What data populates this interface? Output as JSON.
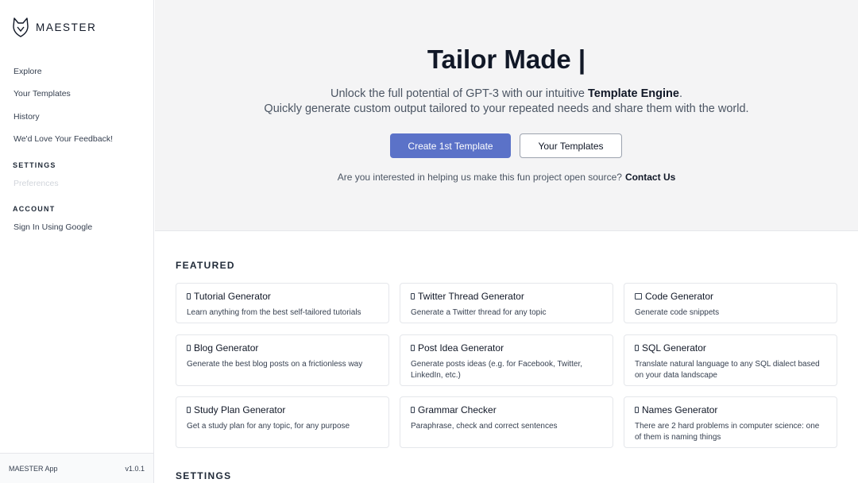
{
  "sidebar": {
    "brand": "MAESTER",
    "nav": [
      {
        "label": "Explore"
      },
      {
        "label": "Your Templates"
      },
      {
        "label": "History"
      },
      {
        "label": "We'd Love Your Feedback!"
      }
    ],
    "settings_heading": "SETTINGS",
    "preferences_label": "Preferences",
    "account_heading": "ACCOUNT",
    "sign_in_label": "Sign In Using Google",
    "footer_app": "MAESTER App",
    "footer_version": "v1.0.1"
  },
  "hero": {
    "title": "Tailor Made |",
    "subtitle_prefix": "Unlock the full potential of GPT-3 with our intuitive ",
    "subtitle_bold": "Template Engine",
    "subtitle_suffix": ".",
    "subtitle_line2": "Quickly generate custom output tailored to your repeated needs and share them with the world.",
    "primary_button": "Create 1st Template",
    "secondary_button": "Your Templates",
    "note": "Are you interested in helping us make this fun project open source?",
    "note_link": "Contact Us"
  },
  "featured": {
    "heading": "FEATURED",
    "cards": [
      {
        "title": "Tutorial Generator",
        "desc": "Learn anything from the best self-tailored tutorials"
      },
      {
        "title": "Twitter Thread Generator",
        "desc": "Generate a Twitter thread for any topic"
      },
      {
        "title": "Code Generator",
        "desc": "Generate code snippets"
      },
      {
        "title": "Blog Generator",
        "desc": "Generate the best blog posts on a frictionless way"
      },
      {
        "title": "Post Idea Generator",
        "desc": "Generate posts ideas (e.g. for Facebook, Twitter, LinkedIn, etc.)"
      },
      {
        "title": "SQL Generator",
        "desc": "Translate natural language to any SQL dialect based on your data landscape"
      },
      {
        "title": "Study Plan Generator",
        "desc": "Get a study plan for any topic, for any purpose"
      },
      {
        "title": "Grammar Checker",
        "desc": "Paraphrase, check and correct sentences"
      },
      {
        "title": "Names Generator",
        "desc": "There are 2 hard problems in computer science: one of them is naming things"
      }
    ]
  },
  "settings_section": {
    "heading": "SETTINGS"
  }
}
